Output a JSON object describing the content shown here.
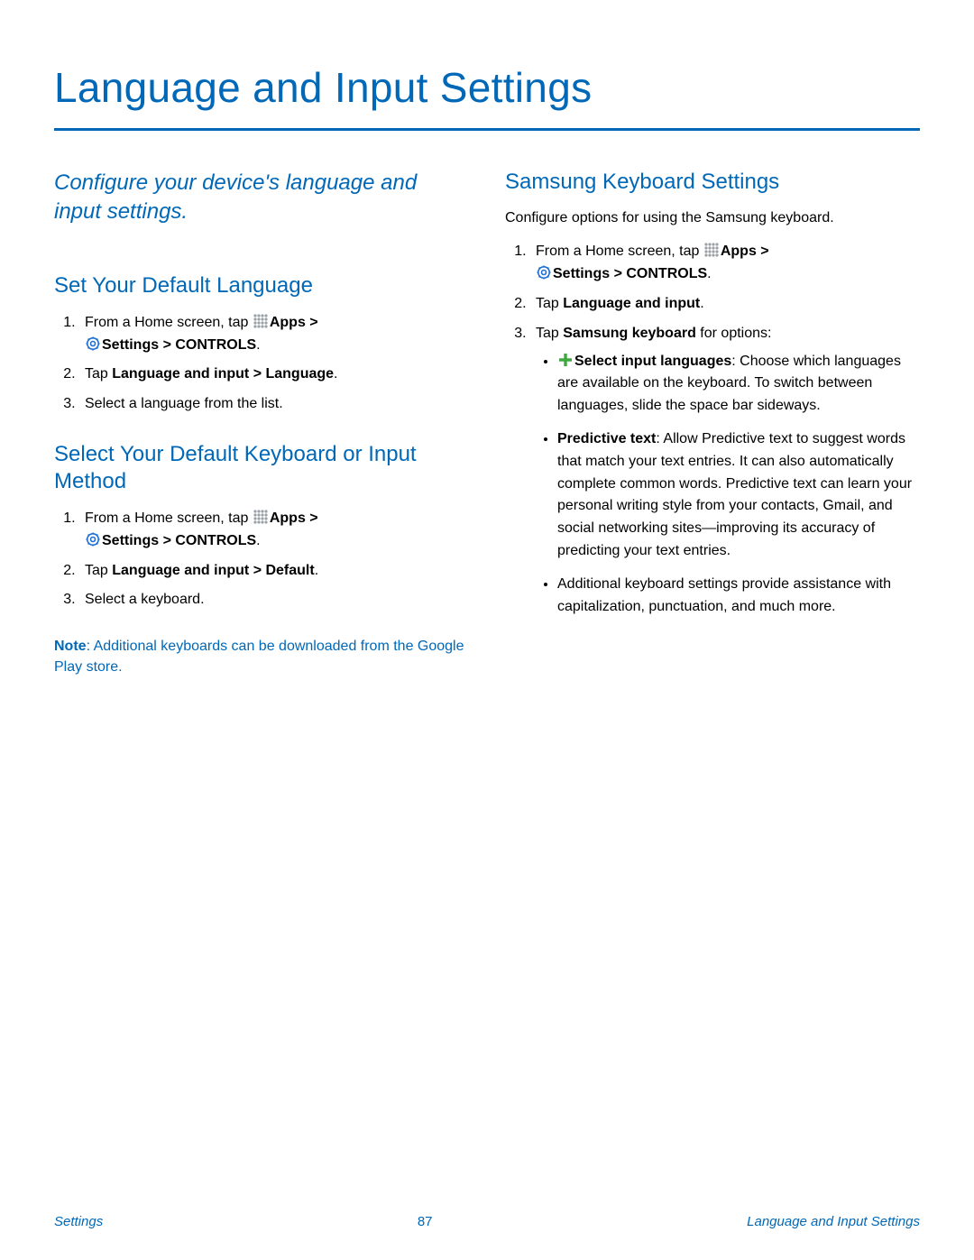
{
  "title": "Language and Input Settings",
  "intro": "Configure your device's language and input settings.",
  "left": {
    "sec1": {
      "heading": "Set Your Default Language",
      "step1_pre": "From a Home screen, tap ",
      "apps": "Apps",
      "gt1": " > ",
      "settings": "Settings",
      "gt2": "  > ",
      "controls": "CONTROLS",
      "period": ".",
      "step2_pre": "Tap ",
      "step2_bold": "Language and input > Language",
      "step3": "Select a language from the list."
    },
    "sec2": {
      "heading": "Select Your Default Keyboard or Input Method",
      "step1_pre": "From a Home screen, tap ",
      "apps": "Apps",
      "gt1": " > ",
      "settings": "Settings",
      "gt2": "  > ",
      "controls": "CONTROLS",
      "period": ".",
      "step2_pre": "Tap ",
      "step2_bold": "Language and input > Default",
      "step3": "Select a keyboard."
    },
    "note_lead": "Note",
    "note_rest": ": Additional keyboards can be downloaded from the Google Play store."
  },
  "right": {
    "heading": "Samsung Keyboard Settings",
    "desc": "Configure options for using the Samsung keyboard.",
    "step1_pre": "From a Home screen, tap ",
    "apps": "Apps",
    "gt1": "  > ",
    "settings": "Settings",
    "gt2": "  > ",
    "controls": "CONTROLS",
    "period": ".",
    "step2_pre": "Tap ",
    "step2_bold": "Language and input",
    "step3_pre": "Tap ",
    "step3_bold": "Samsung keyboard",
    "step3_post": " for options:",
    "bullet1_bold": "Select input languages",
    "bullet1_rest": ": Choose which languages are available on the keyboard. To switch between languages, slide the space bar sideways.",
    "bullet2_bold": "Predictive text",
    "bullet2_rest": ": Allow Predictive text to suggest words that match your text entries. It can also automatically complete common words. Predictive text can learn your personal writing style from your contacts, Gmail, and social networking sites—improving its accuracy of predicting your text entries.",
    "bullet3": "Additional keyboard settings provide assistance with capitalization, punctuation, and much more."
  },
  "footer": {
    "left": "Settings",
    "center": "87",
    "right": "Language and Input Settings"
  }
}
